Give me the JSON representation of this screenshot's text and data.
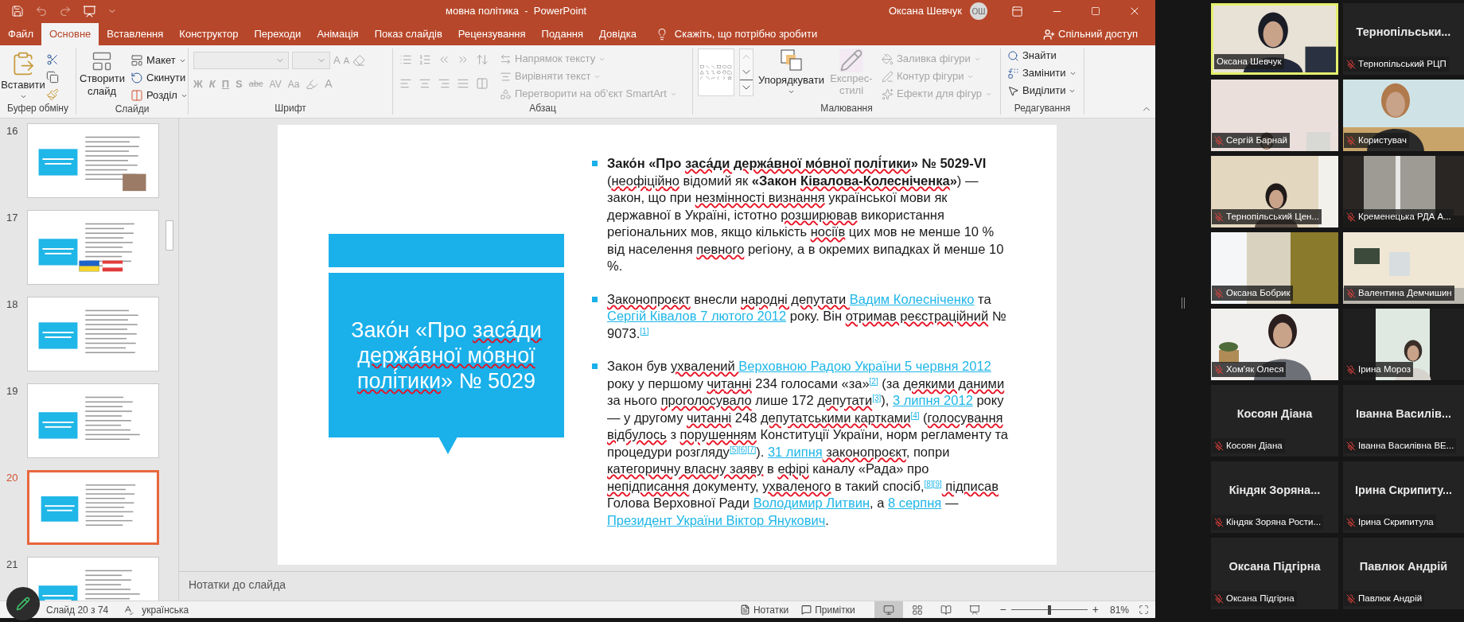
{
  "titlebar": {
    "title": "мовна політика  -  PowerPoint",
    "user": "Оксана Шевчук",
    "avatar": "ОШ"
  },
  "tabs": [
    {
      "label": "Файл",
      "selected": false
    },
    {
      "label": "Основне",
      "selected": true
    },
    {
      "label": "Вставлення",
      "selected": false
    },
    {
      "label": "Конструктор",
      "selected": false
    },
    {
      "label": "Переходи",
      "selected": false
    },
    {
      "label": "Анімація",
      "selected": false
    },
    {
      "label": "Показ слайдів",
      "selected": false
    },
    {
      "label": "Рецензування",
      "selected": false
    },
    {
      "label": "Подання",
      "selected": false
    },
    {
      "label": "Довідка",
      "selected": false
    }
  ],
  "tell_me": "Скажіть, що потрібно зробити",
  "share": "Спільний доступ",
  "ribbon": {
    "clipboard": {
      "label": "Буфер обміну",
      "paste": "Вставити"
    },
    "slides": {
      "label": "Слайди",
      "new_slide": "Створити слайд",
      "layout": "Макет",
      "reset": "Скинути",
      "section": "Розділ"
    },
    "font": {
      "label": "Шрифт",
      "disabled": true,
      "grow": "A",
      "shrink": "A",
      "bold": "Ж",
      "italic": "К",
      "underline": "П",
      "shadow": "S",
      "strike": "abc",
      "spacing": "AV",
      "case": "Aa",
      "font_color": "A"
    },
    "paragraph": {
      "label": "Абзац",
      "disabled": true,
      "text_direction": "Напрямок тексту",
      "align_text": "Вирівняти текст",
      "smartart": "Перетворити на об’єкт SmartArt"
    },
    "drawing": {
      "label": "Малювання",
      "arrange": "Упорядкувати",
      "quick_styles": {
        "label": "Експрес-стилі",
        "disabled": true
      },
      "fill": {
        "label": "Заливка фігури",
        "disabled": true
      },
      "outline": {
        "label": "Контур фігури",
        "disabled": true
      },
      "effects": {
        "label": "Ефекти для фігур",
        "disabled": true
      }
    },
    "editing": {
      "label": "Редагування",
      "find": "Знайти",
      "replace": "Замінити",
      "select": "Виділити"
    }
  },
  "thumbnails": [
    {
      "number": "16",
      "selected": false
    },
    {
      "number": "17",
      "selected": false
    },
    {
      "number": "18",
      "selected": false
    },
    {
      "number": "19",
      "selected": false
    },
    {
      "number": "20",
      "selected": true
    },
    {
      "number": "21",
      "selected": false
    }
  ],
  "slide": {
    "title": [
      {
        "text": "Зако́н «Про ",
        "kind": "plain"
      },
      {
        "text": "заса́ди держа́вної мо́вної полі́тики",
        "kind": "plain",
        "squiggle": true
      },
      {
        "text": "» № 5029",
        "kind": "plain"
      }
    ],
    "bullets": [
      [
        {
          "text": "Зако́н «Про ",
          "kind": "bold"
        },
        {
          "text": "заса́ди держа́вної мо́вної полі́тики",
          "kind": "bold",
          "squiggle": true
        },
        {
          "text": "» № 5029-VI",
          "kind": "bold"
        },
        {
          "text": " (",
          "kind": "plain"
        },
        {
          "text": "неофіційно",
          "kind": "plain",
          "squiggle": true
        },
        {
          "text": " відомий як ",
          "kind": "plain"
        },
        {
          "text": "«Закон ",
          "kind": "bold"
        },
        {
          "text": "Ківалова-Колесніченка",
          "kind": "bold",
          "squiggle": true
        },
        {
          "text": "»",
          "kind": "bold"
        },
        {
          "text": ") — закон, що при ",
          "kind": "plain"
        },
        {
          "text": "незмінності визнання",
          "kind": "plain",
          "squiggle": true
        },
        {
          "text": " української мови як державної в Україні, істотно ",
          "kind": "plain"
        },
        {
          "text": "розширював",
          "kind": "plain",
          "squiggle": true
        },
        {
          "text": " використання регіональних мов, якщо кількість ",
          "kind": "plain"
        },
        {
          "text": "носіїв",
          "kind": "plain",
          "squiggle": true
        },
        {
          "text": " цих мов не менше 10 % від населення ",
          "kind": "plain"
        },
        {
          "text": "певного",
          "kind": "plain",
          "squiggle": true
        },
        {
          "text": " регіону, а в окремих випадках й менше 10 %.",
          "kind": "plain"
        }
      ],
      [
        {
          "text": "Законопроєкт",
          "kind": "plain",
          "squiggle": true
        },
        {
          "text": " внесли ",
          "kind": "plain"
        },
        {
          "text": "народні депутати ",
          "kind": "plain",
          "squiggle": true
        },
        {
          "text": "Вадим Колесніченко",
          "kind": "link"
        },
        {
          "text": " та ",
          "kind": "plain"
        },
        {
          "text": "Сергій Ківалов 7 лютого 2012",
          "kind": "link"
        },
        {
          "text": " року. Він ",
          "kind": "plain"
        },
        {
          "text": "отримав реєстраційний",
          "kind": "plain",
          "squiggle": true
        },
        {
          "text": " № 9073.",
          "kind": "plain"
        },
        {
          "text": "[1]",
          "kind": "ref"
        }
      ],
      [
        {
          "text": "Закон був ",
          "kind": "plain"
        },
        {
          "text": "ухвалений ",
          "kind": "plain",
          "squiggle": true
        },
        {
          "text": "Верховною Радою України 5 червня 2012",
          "kind": "link"
        },
        {
          "text": " року у першому ",
          "kind": "plain"
        },
        {
          "text": "читанні",
          "kind": "plain",
          "squiggle": true
        },
        {
          "text": " 234 голосами «за»",
          "kind": "plain"
        },
        {
          "text": "[2]",
          "kind": "ref"
        },
        {
          "text": " (за ",
          "kind": "plain"
        },
        {
          "text": "деякими даними",
          "kind": "plain",
          "squiggle": true
        },
        {
          "text": " за нього ",
          "kind": "plain"
        },
        {
          "text": "проголосувало",
          "kind": "plain",
          "squiggle": true
        },
        {
          "text": " лише 172 ",
          "kind": "plain"
        },
        {
          "text": "депутати",
          "kind": "plain",
          "squiggle": true
        },
        {
          "text": "[3]",
          "kind": "ref"
        },
        {
          "text": "), ",
          "kind": "plain"
        },
        {
          "text": "3 липня 2012",
          "kind": "link"
        },
        {
          "text": " року — у другому ",
          "kind": "plain"
        },
        {
          "text": "читанні",
          "kind": "plain",
          "squiggle": true
        },
        {
          "text": " 248 ",
          "kind": "plain"
        },
        {
          "text": "депутатськими картками",
          "kind": "plain",
          "squiggle": true
        },
        {
          "text": "[4]",
          "kind": "ref"
        },
        {
          "text": " (",
          "kind": "plain"
        },
        {
          "text": "голосування відбулось",
          "kind": "plain",
          "squiggle": true
        },
        {
          "text": " з ",
          "kind": "plain"
        },
        {
          "text": "порушенням",
          "kind": "plain",
          "squiggle": true
        },
        {
          "text": " Конституції України, норм регламенту та процедури розгляду",
          "kind": "plain"
        },
        {
          "text": "[5]",
          "kind": "ref"
        },
        {
          "text": "[6]",
          "kind": "ref"
        },
        {
          "text": "[7]",
          "kind": "ref"
        },
        {
          "text": "). ",
          "kind": "plain"
        },
        {
          "text": "31 липня",
          "kind": "link"
        },
        {
          "text": " законопроєкт",
          "kind": "plain",
          "squiggle": true
        },
        {
          "text": ", попри ",
          "kind": "plain"
        },
        {
          "text": "категоричну власну заяву",
          "kind": "plain",
          "squiggle": true
        },
        {
          "text": " в ",
          "kind": "plain"
        },
        {
          "text": "ефірі",
          "kind": "plain",
          "squiggle": true
        },
        {
          "text": " каналу «Рада» про ",
          "kind": "plain"
        },
        {
          "text": "непідписання",
          "kind": "plain",
          "squiggle": true
        },
        {
          "text": " документу, ",
          "kind": "plain"
        },
        {
          "text": "ухваленого",
          "kind": "plain",
          "squiggle": true
        },
        {
          "text": " в такий спосіб,",
          "kind": "plain"
        },
        {
          "text": "[8]",
          "kind": "ref"
        },
        {
          "text": "[9]",
          "kind": "ref"
        },
        {
          "text": " підписав",
          "kind": "plain",
          "squiggle": true
        },
        {
          "text": " Голова Верховної Ради ",
          "kind": "plain"
        },
        {
          "text": "Володимир Литвин",
          "kind": "link"
        },
        {
          "text": ", а ",
          "kind": "plain"
        },
        {
          "text": "8 серпня",
          "kind": "link"
        },
        {
          "text": " — ",
          "kind": "plain"
        },
        {
          "text": "Президент України Віктор Янукович",
          "kind": "link"
        },
        {
          "text": ".",
          "kind": "plain"
        }
      ]
    ]
  },
  "notes_placeholder": "Нотатки до слайда",
  "status_bar": {
    "slide": "Слайд 20 з 74",
    "language": "українська",
    "notes": "Нотатки",
    "comments": "Примітки",
    "views": [
      {
        "selected": true
      },
      {
        "selected": false
      },
      {
        "selected": false
      },
      {
        "selected": false
      }
    ],
    "zoom": {
      "minus": "−",
      "plus": "+",
      "level": 0.5,
      "reading": "81%"
    }
  },
  "gallery": [
    {
      "kind": "video",
      "name": "Оксана Шевчук",
      "muted": false,
      "speaking": true
    },
    {
      "kind": "name",
      "title": "Тернопільськи...",
      "name": "Тернопільський РЦП",
      "muted": true,
      "speaking": false
    },
    {
      "kind": "video",
      "name": "Сергій Барнай",
      "muted": true,
      "speaking": false
    },
    {
      "kind": "video",
      "name": "Користувач",
      "muted": true,
      "speaking": false
    },
    {
      "kind": "video",
      "name": "Тернопільський Цен...",
      "muted": true,
      "speaking": false
    },
    {
      "kind": "video",
      "name": "Кременецька РДА А...",
      "muted": true,
      "speaking": false
    },
    {
      "kind": "video",
      "name": "Оксана Бобрик",
      "muted": true,
      "speaking": false
    },
    {
      "kind": "video",
      "name": "Валентина Демчишин",
      "muted": true,
      "speaking": false
    },
    {
      "kind": "video",
      "name": "Хом'як Олеся",
      "muted": true,
      "speaking": false
    },
    {
      "kind": "video",
      "name": "Ірина Мороз",
      "muted": true,
      "speaking": false
    },
    {
      "kind": "name",
      "title": "Косоян Діана",
      "name": "Косоян Діана",
      "muted": true,
      "speaking": false
    },
    {
      "kind": "name",
      "title": "Іванна  Василів...",
      "name": "Іванна Василівна ВЕ...",
      "muted": true,
      "speaking": false
    },
    {
      "kind": "name",
      "title": "Кіндяк  Зоряна...",
      "name": "Кіндяк Зоряна Рости...",
      "muted": true,
      "speaking": false
    },
    {
      "kind": "name",
      "title": "Ірина  Скрипиту...",
      "name": "Ірина Скрипитула",
      "muted": true,
      "speaking": false
    },
    {
      "kind": "name",
      "title": "Оксана Підгірна",
      "name": "Оксана Підгірна",
      "muted": true,
      "speaking": false
    },
    {
      "kind": "name",
      "title": "Павлюк Андрій",
      "name": "Павлюк Андрій",
      "muted": true,
      "speaking": false
    }
  ]
}
